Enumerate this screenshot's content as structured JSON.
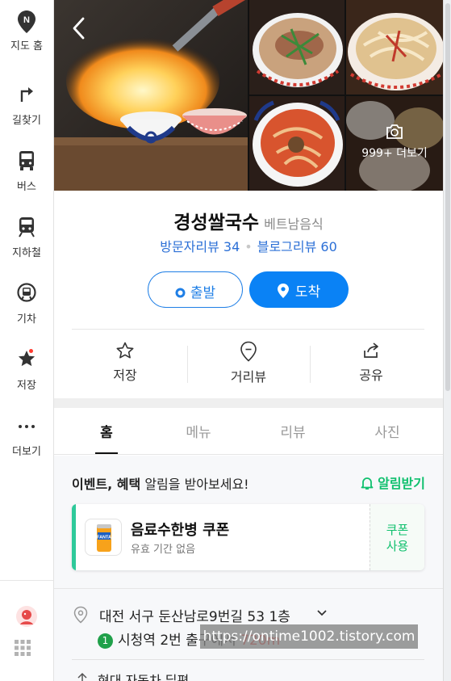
{
  "rail": {
    "items": [
      {
        "label": "지도 홈",
        "icon": "naver-map-logo-icon"
      },
      {
        "label": "길찾기",
        "icon": "directions-arrow-icon"
      },
      {
        "label": "버스",
        "icon": "bus-icon"
      },
      {
        "label": "지하철",
        "icon": "subway-icon"
      },
      {
        "label": "기차",
        "icon": "train-icon"
      },
      {
        "label": "저장",
        "icon": "star-icon"
      },
      {
        "label": "더보기",
        "icon": "more-dots-icon"
      }
    ]
  },
  "photos": {
    "more_label": "999+ 더보기"
  },
  "place": {
    "name": "경성쌀국수",
    "category": "베트남음식",
    "visitor_review_label": "방문자리뷰 34",
    "blog_review_label": "블로그리뷰 60"
  },
  "route": {
    "start_label": "출발",
    "arrive_label": "도착"
  },
  "actions": [
    {
      "label": "저장",
      "icon": "star-outline-icon"
    },
    {
      "label": "거리뷰",
      "icon": "street-view-pin-icon"
    },
    {
      "label": "공유",
      "icon": "share-icon"
    }
  ],
  "tabs": [
    "홈",
    "메뉴",
    "리뷰",
    "사진"
  ],
  "active_tab": "홈",
  "notice": {
    "bold": "이벤트, 혜택",
    "rest": " 알림을 받아보세요!",
    "link_label": "알림받기"
  },
  "coupon": {
    "title": "음료수한병 쿠폰",
    "subtitle": "유효 기간 없음",
    "action_line1": "쿠폰",
    "action_line2": "사용",
    "thumb_text": "FANTA"
  },
  "address": {
    "text": "대전 서구 둔산남로9번길 53 1층"
  },
  "subway": {
    "line": "1",
    "text": "시청역 2번 출구에서 ",
    "distance": "720m"
  },
  "watermark": "https://ontime1002.tistory.com",
  "next_row": "현대 자동차 딜편",
  "colors": {
    "primary_blue": "#0a82f5",
    "review_blue": "#2b6fd6",
    "green": "#10c06e",
    "coupon_bar": "#2ec99a",
    "line1_green": "#20a04a",
    "distance_red": "#e8413b"
  }
}
